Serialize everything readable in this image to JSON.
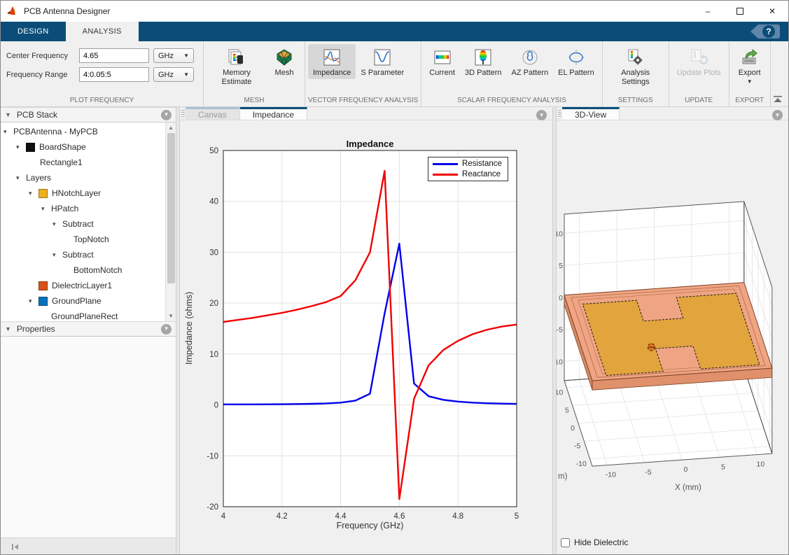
{
  "window": {
    "title": "PCB Antenna Designer",
    "minimize": "–",
    "close": "✕"
  },
  "ribbon": {
    "tabs": [
      {
        "label": "DESIGN",
        "active": false
      },
      {
        "label": "ANALYSIS",
        "active": true
      }
    ],
    "help_label": "?"
  },
  "toolstrip": {
    "plot_frequency": {
      "label": "PLOT FREQUENCY",
      "center_frequency": {
        "label": "Center Frequency",
        "value": "4.65",
        "unit": "GHz"
      },
      "frequency_range": {
        "label": "Frequency Range",
        "value": "4:0.05:5",
        "unit": "GHz"
      }
    },
    "mesh": {
      "label": "MESH",
      "buttons": [
        "Memory Estimate",
        "Mesh"
      ]
    },
    "vector": {
      "label": "VECTOR FREQUENCY ANALYSIS",
      "buttons": [
        "Impedance",
        "S Parameter"
      ],
      "selected": "Impedance"
    },
    "scalar": {
      "label": "SCALAR FREQUENCY ANALYSIS",
      "buttons": [
        "Current",
        "3D Pattern",
        "AZ Pattern",
        "EL Pattern"
      ]
    },
    "settings": {
      "label": "SETTINGS",
      "buttons": [
        "Analysis Settings"
      ]
    },
    "update": {
      "label": "UPDATE",
      "buttons": [
        "Update Plots"
      ],
      "disabled": true
    },
    "export": {
      "label": "EXPORT",
      "buttons": [
        "Export"
      ]
    }
  },
  "pcb_stack": {
    "title": "PCB Stack",
    "items": [
      {
        "label": "PCBAntenna - MyPCB",
        "ind": 4,
        "arrow": true
      },
      {
        "label": "BoardShape",
        "ind": 22,
        "arrow": true,
        "icon": "#101010"
      },
      {
        "label": "Rectangle1",
        "ind": 56,
        "arrow": false
      },
      {
        "label": "Layers",
        "ind": 22,
        "arrow": true
      },
      {
        "label": "HNotchLayer",
        "ind": 40,
        "arrow": true,
        "icon": "#EDB120"
      },
      {
        "label": "HPatch",
        "ind": 58,
        "arrow": true
      },
      {
        "label": "Subtract",
        "ind": 74,
        "arrow": true
      },
      {
        "label": "TopNotch",
        "ind": 104,
        "arrow": false
      },
      {
        "label": "Subtract",
        "ind": 74,
        "arrow": true
      },
      {
        "label": "BottomNotch",
        "ind": 104,
        "arrow": false
      },
      {
        "label": "DielectricLayer1",
        "ind": 54,
        "arrow": false,
        "icon": "#D95319"
      },
      {
        "label": "GroundPlane",
        "ind": 40,
        "arrow": true,
        "icon": "#0072BD"
      },
      {
        "label": "GroundPlaneRect",
        "ind": 72,
        "arrow": false
      }
    ]
  },
  "properties": {
    "title": "Properties"
  },
  "doc_tabs": {
    "canvas": "Canvas",
    "impedance": "Impedance",
    "active": "Impedance"
  },
  "view3d": {
    "tab": "3D-View",
    "x_axis": {
      "label": "X (mm)",
      "ticks": [
        "-10",
        "-5",
        "0",
        "5",
        "10"
      ]
    },
    "y_axis": {
      "label_partial": "m)",
      "ticks": [
        "10",
        "5",
        "0",
        "-5",
        "-10"
      ]
    },
    "z_axis": {
      "ticks": [
        "10",
        "5",
        "0",
        "-5",
        "-10"
      ]
    },
    "hide_dielectric_label": "Hide Dielectric",
    "colors": {
      "dielectric": "#EFA584",
      "patch": "#E2A43C",
      "feed": "#E8731F"
    }
  },
  "chart_data": {
    "type": "line",
    "title": "Impedance",
    "xlabel": "Frequency (GHz)",
    "ylabel": "Impedance (ohms)",
    "xlim": [
      4,
      5
    ],
    "ylim": [
      -20,
      50
    ],
    "xticks": [
      4,
      4.2,
      4.4,
      4.6,
      4.8,
      5
    ],
    "yticks": [
      -20,
      -10,
      0,
      10,
      20,
      30,
      40,
      50
    ],
    "grid": true,
    "legend_position": "top-right",
    "x": [
      4,
      4.05,
      4.1,
      4.15,
      4.2,
      4.25,
      4.3,
      4.35,
      4.4,
      4.45,
      4.5,
      4.55,
      4.6,
      4.65,
      4.7,
      4.75,
      4.8,
      4.85,
      4.9,
      4.95,
      5
    ],
    "series": [
      {
        "name": "Resistance",
        "color": "#0000EB",
        "values": [
          0.1,
          0.1,
          0.1,
          0.12,
          0.14,
          0.17,
          0.22,
          0.3,
          0.45,
          0.85,
          2.2,
          18,
          31.7,
          4.2,
          1.7,
          1.0,
          0.65,
          0.45,
          0.33,
          0.26,
          0.2
        ]
      },
      {
        "name": "Reactance",
        "color": "#F20000",
        "values": [
          16.3,
          16.7,
          17.1,
          17.6,
          18.1,
          18.7,
          19.4,
          20.2,
          21.4,
          24.5,
          30,
          46,
          -18.5,
          1.2,
          7.8,
          10.8,
          12.6,
          13.9,
          14.8,
          15.4,
          15.8
        ]
      }
    ]
  }
}
